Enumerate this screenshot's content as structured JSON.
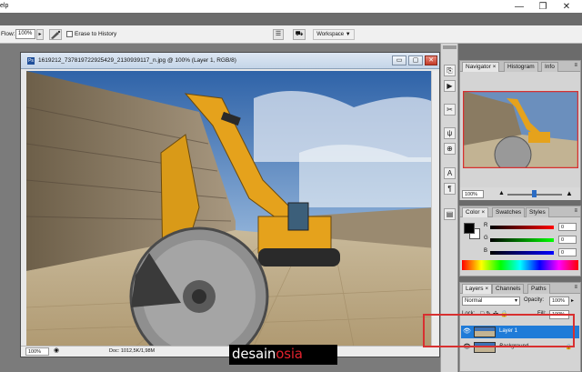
{
  "app": {
    "menu_fragment": "elp"
  },
  "window_controls": {
    "minimize": "—",
    "restore": "❐",
    "close": "✕"
  },
  "options_bar": {
    "flow_label": "Flow:",
    "flow_value": "100%",
    "erase_to_history": "Erase to History",
    "workspace": "Workspace ▼"
  },
  "document": {
    "icon": "Ps",
    "title": "1619212_737819722925429_2130939117_n.jpg @ 100% (Layer 1, RGB/8)",
    "zoom": "100%",
    "doc_info": "Doc: 1012,5K/1,98M"
  },
  "watermark": {
    "part1": "desain",
    "part2": "osia"
  },
  "navigator": {
    "tabs": [
      "Navigator ×",
      "Histogram",
      "Info"
    ],
    "zoom": "100%",
    "zoom_level_fraction": 0.5
  },
  "color_panel": {
    "tabs": [
      "Color ×",
      "Swatches",
      "Styles"
    ],
    "channels": [
      {
        "label": "R",
        "value": "0"
      },
      {
        "label": "G",
        "value": "0"
      },
      {
        "label": "B",
        "value": "0"
      }
    ],
    "foreground": "#000000",
    "background": "#ffffff"
  },
  "layers_panel": {
    "tabs": [
      "Layers ×",
      "Channels",
      "Paths"
    ],
    "blend_mode": "Normal",
    "opacity_label": "Opacity:",
    "opacity_value": "100%",
    "lock_label": "Lock:",
    "fill_label": "Fill:",
    "fill_value": "100%",
    "layers": [
      {
        "name": "Layer 1",
        "selected": true
      },
      {
        "name": "Background",
        "selected": false
      }
    ]
  },
  "colors": {
    "selection": "#1f7bd8",
    "highlight_box": "#d83030",
    "sky": "#3f72b5",
    "excavator": "#e5a21c"
  }
}
